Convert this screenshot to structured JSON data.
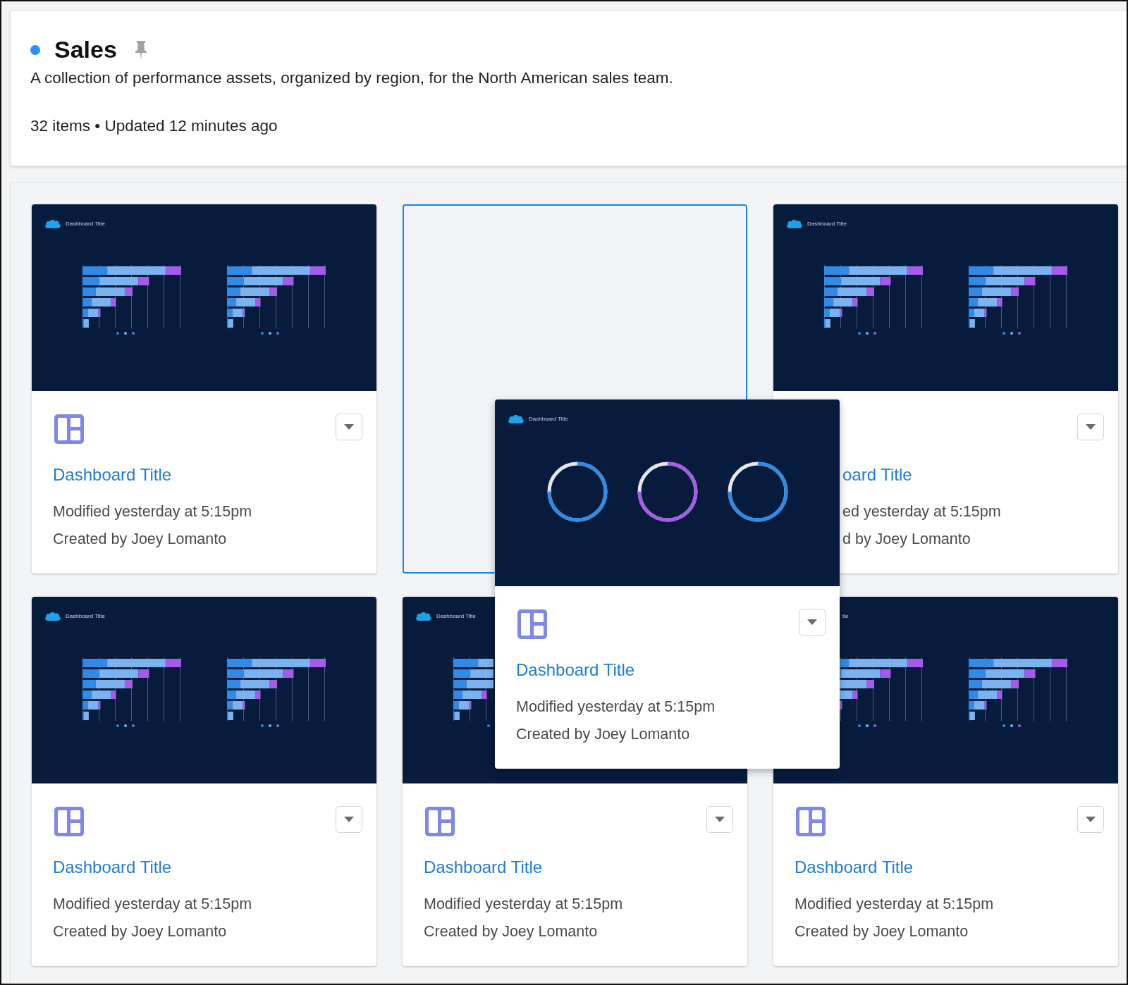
{
  "header": {
    "title": "Sales",
    "description": "A collection of performance assets, organized by region, for the North American sales team.",
    "meta": "32 items • Updated 12 minutes ago"
  },
  "cards": [
    {
      "kind": "full",
      "thumbnail": {
        "kind": "bars",
        "title": "Dashboard Title"
      },
      "title": "Dashboard Title",
      "modified": "Modified yesterday at 5:15pm",
      "created": "Created by Joey Lomanto"
    },
    {
      "kind": "placeholder"
    },
    {
      "kind": "body-covered",
      "thumbnail": {
        "kind": "bars",
        "title": "Dashboard Title"
      },
      "title": "oard Title",
      "modified": "ed yesterday at 5:15pm",
      "created": "d by Joey Lomanto"
    },
    {
      "kind": "full",
      "thumbnail": {
        "kind": "bars",
        "title": "Dashboard Title"
      },
      "title": "Dashboard Title",
      "modified": "Modified yesterday at 5:15pm",
      "created": "Created by Joey Lomanto"
    },
    {
      "kind": "full",
      "thumbnail": {
        "kind": "bars",
        "title": "Dashboard Title"
      },
      "title": "Dashboard Title",
      "modified": "Modified yesterday at 5:15pm",
      "created": "Created by Joey Lomanto"
    },
    {
      "kind": "thumb-covered",
      "thumbnail": {
        "kind": "bars",
        "title": "tle"
      },
      "title": "Dashboard Title",
      "modified": "Modified yesterday at 5:15pm",
      "created": "Created by Joey Lomanto"
    }
  ],
  "dragged_card": {
    "thumbnail": {
      "kind": "rings",
      "title": "Dashboard Title"
    },
    "title": "Dashboard Title",
    "modified": "Modified yesterday at 5:15pm",
    "created": "Created by Joey Lomanto"
  }
}
